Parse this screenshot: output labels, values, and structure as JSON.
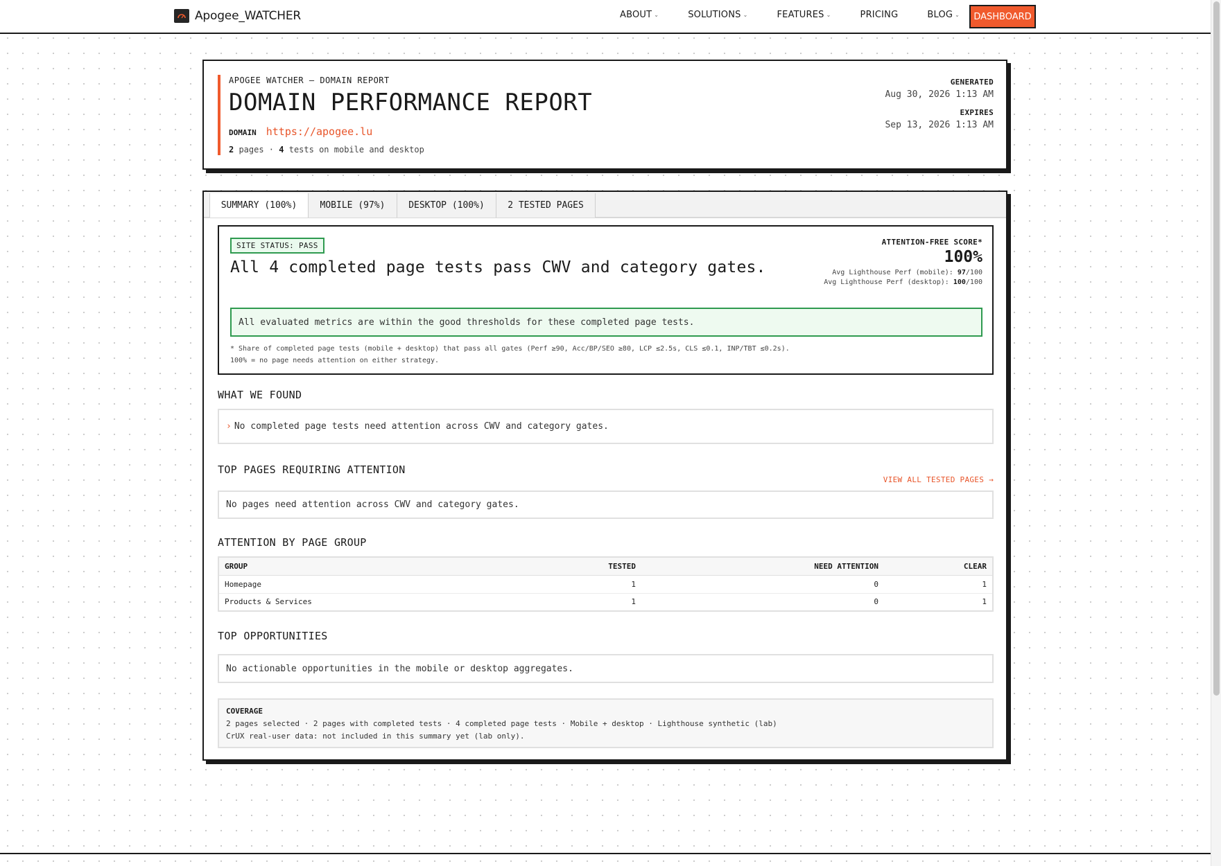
{
  "nav": {
    "brand": "Apogee_WATCHER",
    "links": [
      {
        "label": "ABOUT",
        "has_menu": true
      },
      {
        "label": "SOLUTIONS",
        "has_menu": true
      },
      {
        "label": "FEATURES",
        "has_menu": true
      },
      {
        "label": "PRICING",
        "has_menu": false
      },
      {
        "label": "BLOG",
        "has_menu": true
      }
    ],
    "cta": "DASHBOARD",
    "chevron": "⌄"
  },
  "colors": {
    "accent": "#f05a2d",
    "pass_green": "#2e9a4f",
    "ink": "#1a1a1a"
  },
  "header": {
    "eyebrow": "APOGEE WATCHER – DOMAIN REPORT",
    "title": "DOMAIN PERFORMANCE REPORT",
    "domain_label": "DOMAIN",
    "domain_url": "https://apogee.lu",
    "pages_count": "2",
    "pages_text": " pages · ",
    "tests_count": "4",
    "tests_text": " tests on mobile and desktop",
    "generated_label": "GENERATED",
    "generated_value": "Aug 30, 2026 1:13 AM",
    "expires_label": "EXPIRES",
    "expires_value": "Sep 13, 2026 1:13 AM"
  },
  "tabs": [
    {
      "label": "SUMMARY (100%)",
      "active": true
    },
    {
      "label": "MOBILE (97%)",
      "active": false
    },
    {
      "label": "DESKTOP (100%)",
      "active": false
    },
    {
      "label": "2 TESTED PAGES",
      "active": false
    }
  ],
  "summary": {
    "badge": "SITE STATUS: PASS",
    "headline": "All 4 completed page tests pass CWV and category gates.",
    "score_label": "ATTENTION-FREE SCORE*",
    "score_value": "100%",
    "avg_mobile_label": "Avg Lighthouse Perf (mobile): ",
    "avg_mobile_value": "97",
    "avg_mobile_total": "/100",
    "avg_desktop_label": "Avg Lighthouse Perf (desktop): ",
    "avg_desktop_value": "100",
    "avg_desktop_total": "/100",
    "good_message": "All evaluated metrics are within the good thresholds for these completed page tests.",
    "footnote_1": "* Share of completed page tests (mobile + desktop) that pass all gates (Perf ≥90, Acc/BP/SEO ≥80, LCP ≤2.5s, CLS ≤0.1, INP/TBT ≤0.2s).",
    "footnote_2": "100% = no page needs attention on either strategy."
  },
  "found": {
    "title": "WHAT WE FOUND",
    "bullet": "›",
    "item": "No completed page tests need attention across CWV and category gates."
  },
  "top_pages": {
    "title": "TOP PAGES REQUIRING ATTENTION",
    "view_all": "VIEW ALL TESTED PAGES →",
    "empty": "No pages need attention across CWV and category gates."
  },
  "groups": {
    "title": "ATTENTION BY PAGE GROUP",
    "columns": [
      "GROUP",
      "TESTED",
      "NEED ATTENTION",
      "CLEAR"
    ],
    "rows": [
      [
        "Homepage",
        "1",
        "0",
        "1"
      ],
      [
        "Products & Services",
        "1",
        "0",
        "1"
      ]
    ]
  },
  "opportunities": {
    "title": "TOP OPPORTUNITIES",
    "empty": "No actionable opportunities in the mobile or desktop aggregates."
  },
  "coverage": {
    "title": "COVERAGE",
    "line1": "2 pages selected · 2 pages with completed tests · 4 completed page tests · Mobile + desktop · Lighthouse synthetic (lab)",
    "line2": "CrUX real-user data: not included in this summary yet (lab only)."
  }
}
